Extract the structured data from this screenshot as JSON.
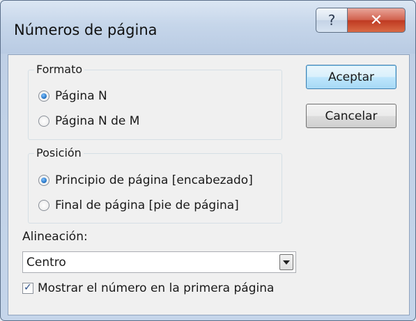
{
  "window": {
    "title": "Números de página",
    "help_glyph": "?",
    "close_glyph": "✕"
  },
  "formato": {
    "legend": "Formato",
    "options": [
      {
        "label": "Página N",
        "checked": true
      },
      {
        "label": "Página N de M",
        "checked": false
      }
    ]
  },
  "posicion": {
    "legend": "Posición",
    "options": [
      {
        "label": "Principio de página [encabezado]",
        "checked": true
      },
      {
        "label": "Final de página [pie de página]",
        "checked": false
      }
    ]
  },
  "buttons": {
    "accept_label": "Aceptar",
    "cancel_label": "Cancelar"
  },
  "alineacion": {
    "label": "Alineación:",
    "selected": "Centro"
  },
  "first_page_checkbox": {
    "label": "Mostrar el número en la primera página",
    "checked": true,
    "check_glyph": "✓"
  },
  "colors": {
    "accent": "#1f6fbf",
    "close_button": "#c8452c",
    "default_button_border": "#3c7fb1"
  }
}
